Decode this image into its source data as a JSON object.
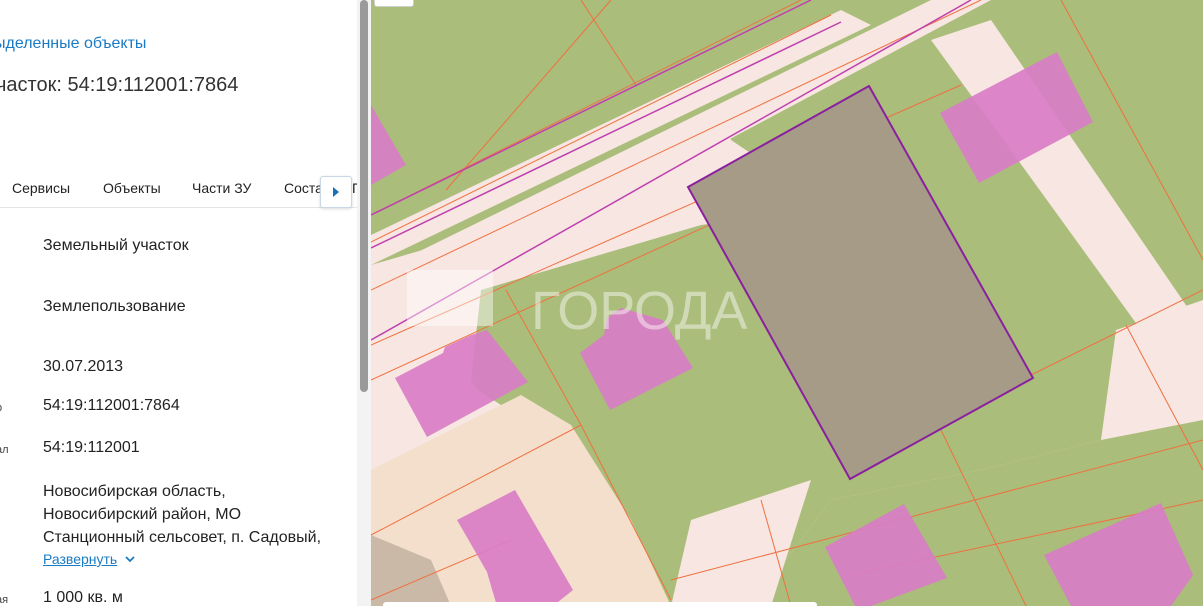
{
  "panel": {
    "back_link": "ыделенные объекты",
    "title": "участок: 54:19:112001:7864",
    "tabs": [
      "Сервисы",
      "Объекты",
      "Части ЗУ",
      "Соста",
      "Г"
    ],
    "rows": [
      {
        "label": "",
        "value": "Земельный участок"
      },
      {
        "label": "",
        "value": "Землепользование"
      },
      {
        "label": "",
        "value": "30.07.2013"
      },
      {
        "label": "р",
        "value": "54:19:112001:7864"
      },
      {
        "label": "ал",
        "value": "54:19:112001"
      }
    ],
    "address_lines": [
      "Новосибирская область,",
      "Новосибирский район, МО",
      "Станционный сельсовет, п. Садовый,"
    ],
    "expand_label": "Развернуть",
    "area_label": "ая",
    "area_value": "1 000 кв. м"
  },
  "map": {
    "watermark": "ГОРОДА",
    "colors": {
      "background": "#f7e6e1",
      "green": "#aabd7a",
      "building": "#d97dc6",
      "selected": "#a69b86",
      "selected_border": "#8a1fa0",
      "boundary": "#f07040",
      "road_line": "#c040b0"
    }
  },
  "icons": {
    "tab_scroll": "chevron-right-icon",
    "expand": "chevron-down-icon"
  }
}
